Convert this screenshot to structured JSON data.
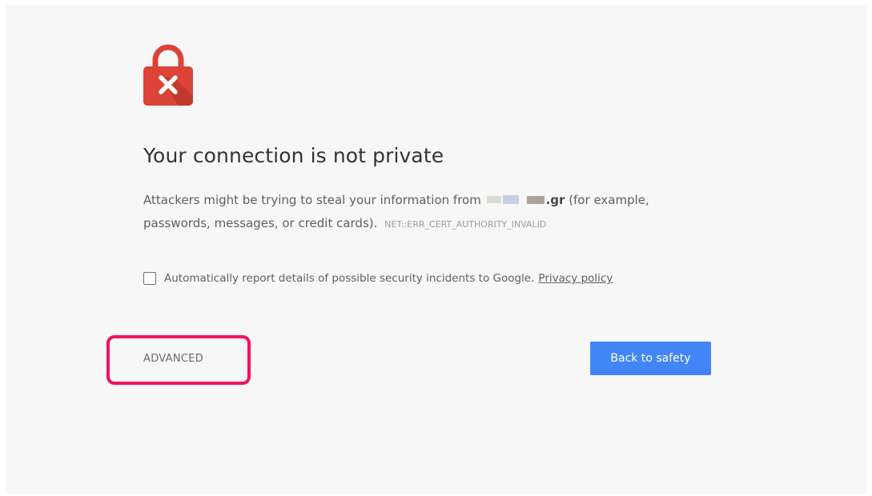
{
  "interstitial": {
    "title": "Your connection is not private",
    "description_prefix": "Attackers might be trying to steal your information from ",
    "domain_suffix": ".gr",
    "description_middle": " (for example,",
    "description_line2": "passwords, messages, or credit cards).",
    "error_code": "NET::ERR_CERT_AUTHORITY_INVALID",
    "report_label": "Automatically report details of possible security incidents to Google.",
    "privacy_link": "Privacy policy",
    "advanced_label": "ADVANCED",
    "back_label": "Back to safety",
    "icon": "broken-lock-icon"
  },
  "colors": {
    "lock_red": "#db4437",
    "button_blue": "#4285f4",
    "highlight": "#f2135a",
    "background": "#f7f7f7"
  }
}
